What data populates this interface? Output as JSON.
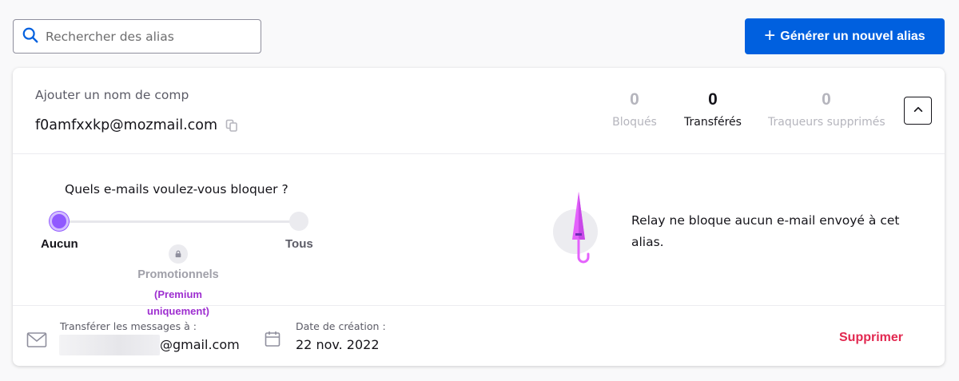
{
  "search": {
    "placeholder": "Rechercher des alias",
    "value": ""
  },
  "generate_button": {
    "label": "Générer un nouvel alias"
  },
  "alias": {
    "label_placeholder": "Ajouter un nom de comp",
    "address": "f0amfxxkp@mozmail.com"
  },
  "stats": [
    {
      "value": "0",
      "label": "Bloqués"
    },
    {
      "value": "0",
      "label": "Transférés"
    },
    {
      "value": "0",
      "label": "Traqueurs supprimés"
    }
  ],
  "blocking": {
    "question": "Quels e-mails voulez-vous bloquer ?",
    "options": [
      {
        "label": "Aucun",
        "selected": true
      },
      {
        "label": "Promotionnels",
        "note": "(Premium uniquement)",
        "locked": true
      },
      {
        "label": "Tous",
        "selected": false
      }
    ],
    "status_message": "Relay ne bloque aucun e-mail envoyé à cet alias."
  },
  "footer": {
    "forward_label": "Transférer les messages à :",
    "forward_value": "@gmail.com",
    "created_label": "Date de création :",
    "created_value": "22 nov. 2022",
    "delete_label": "Supprimer"
  },
  "colors": {
    "primary": "#0060df",
    "accent_purple": "#9059ff",
    "premium_purple": "#9e2fd0",
    "danger": "#e22850",
    "umbrella_pink": "#e462fc"
  },
  "icons": [
    "search-icon",
    "plus-icon",
    "copy-icon",
    "chevron-up-icon",
    "lock-icon",
    "umbrella-icon",
    "mail-icon",
    "calendar-icon"
  ]
}
